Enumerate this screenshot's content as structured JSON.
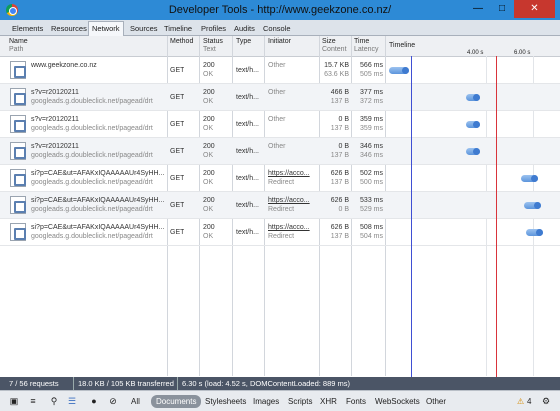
{
  "window": {
    "title": "Developer Tools - http://www.geekzone.co.nz/"
  },
  "tabs": [
    "Elements",
    "Resources",
    "Network",
    "Sources",
    "Timeline",
    "Profiles",
    "Audits",
    "Console"
  ],
  "active_tab": "Network",
  "columns": {
    "name": "Name",
    "path": "Path",
    "method": "Method",
    "status": "Status",
    "status_text": "Text",
    "type": "Type",
    "initiator": "Initiator",
    "size": "Size",
    "size_content": "Content",
    "time": "Time",
    "latency": "Latency",
    "timeline": "Timeline",
    "marker_4": "4.00 s",
    "marker_6": "6.00 s"
  },
  "requests": [
    {
      "name": "www.geekzone.co.nz",
      "path": "",
      "method": "GET",
      "status": "200",
      "status_text": "OK",
      "type": "text/h...",
      "initiator": "",
      "initiator_sub": "Other",
      "size": "15.7 KB",
      "content": "63.6 KB",
      "time": "566 ms",
      "latency": "505 ms",
      "bar_start": 0.0,
      "bar_end": 0.13
    },
    {
      "name": "s?v=r20120211",
      "path": "googleads.g.doubleclick.net/pagead/drt",
      "method": "GET",
      "status": "200",
      "status_text": "OK",
      "type": "text/h...",
      "initiator": "",
      "initiator_sub": "Other",
      "size": "466 B",
      "content": "137 B",
      "time": "377 ms",
      "latency": "372 ms",
      "bar_start": 0.49,
      "bar_end": 0.58
    },
    {
      "name": "s?v=r20120211",
      "path": "googleads.g.doubleclick.net/pagead/drt",
      "method": "GET",
      "status": "200",
      "status_text": "OK",
      "type": "text/h...",
      "initiator": "",
      "initiator_sub": "Other",
      "size": "0 B",
      "content": "137 B",
      "time": "359 ms",
      "latency": "359 ms",
      "bar_start": 0.49,
      "bar_end": 0.58
    },
    {
      "name": "s?v=r20120211",
      "path": "googleads.g.doubleclick.net/pagead/drt",
      "method": "GET",
      "status": "200",
      "status_text": "OK",
      "type": "text/h...",
      "initiator": "",
      "initiator_sub": "Other",
      "size": "0 B",
      "content": "137 B",
      "time": "346 ms",
      "latency": "346 ms",
      "bar_start": 0.49,
      "bar_end": 0.58
    },
    {
      "name": "si?p=CAE&ut=AFAKxIQAAAAAUr4SyHH...",
      "path": "googleads.g.doubleclick.net/pagead/drt",
      "method": "GET",
      "status": "200",
      "status_text": "OK",
      "type": "text/h...",
      "initiator": "https://acco...",
      "initiator_sub": "Redirect",
      "size": "626 B",
      "content": "137 B",
      "time": "502 ms",
      "latency": "500 ms",
      "bar_start": 0.84,
      "bar_end": 0.95
    },
    {
      "name": "si?p=CAE&ut=AFAKxIQAAAAAUr4SyHH...",
      "path": "googleads.g.doubleclick.net/pagead/drt",
      "method": "GET",
      "status": "200",
      "status_text": "OK",
      "type": "text/h...",
      "initiator": "https://acco...",
      "initiator_sub": "Redirect",
      "size": "626 B",
      "content": "0 B",
      "time": "533 ms",
      "latency": "529 ms",
      "bar_start": 0.86,
      "bar_end": 0.97
    },
    {
      "name": "si?p=CAE&ut=AFAKxIQAAAAAUr4SyHH...",
      "path": "googleads.g.doubleclick.net/pagead/drt",
      "method": "GET",
      "status": "200",
      "status_text": "OK",
      "type": "text/h...",
      "initiator": "https://acco...",
      "initiator_sub": "Redirect",
      "size": "626 B",
      "content": "137 B",
      "time": "508 ms",
      "latency": "504 ms",
      "bar_start": 0.87,
      "bar_end": 0.98
    }
  ],
  "status": {
    "requests": "7 / 56 requests",
    "transferred": "18.0 KB / 105 KB transferred",
    "timing": "6.30 s (load: 4.52 s, DOMContentLoaded: 889 ms)"
  },
  "toolbar": {
    "filters": [
      "All",
      "Documents",
      "Stylesheets",
      "Images",
      "Scripts",
      "XHR",
      "Fonts",
      "WebSockets",
      "Other"
    ],
    "active_filter": "Documents",
    "warnings": "4"
  },
  "colors": {
    "title_bar": "#2d8ad6",
    "status_bar": "#4b5566",
    "dom_line": "#3f4fd3",
    "load_line": "#d9343b"
  }
}
